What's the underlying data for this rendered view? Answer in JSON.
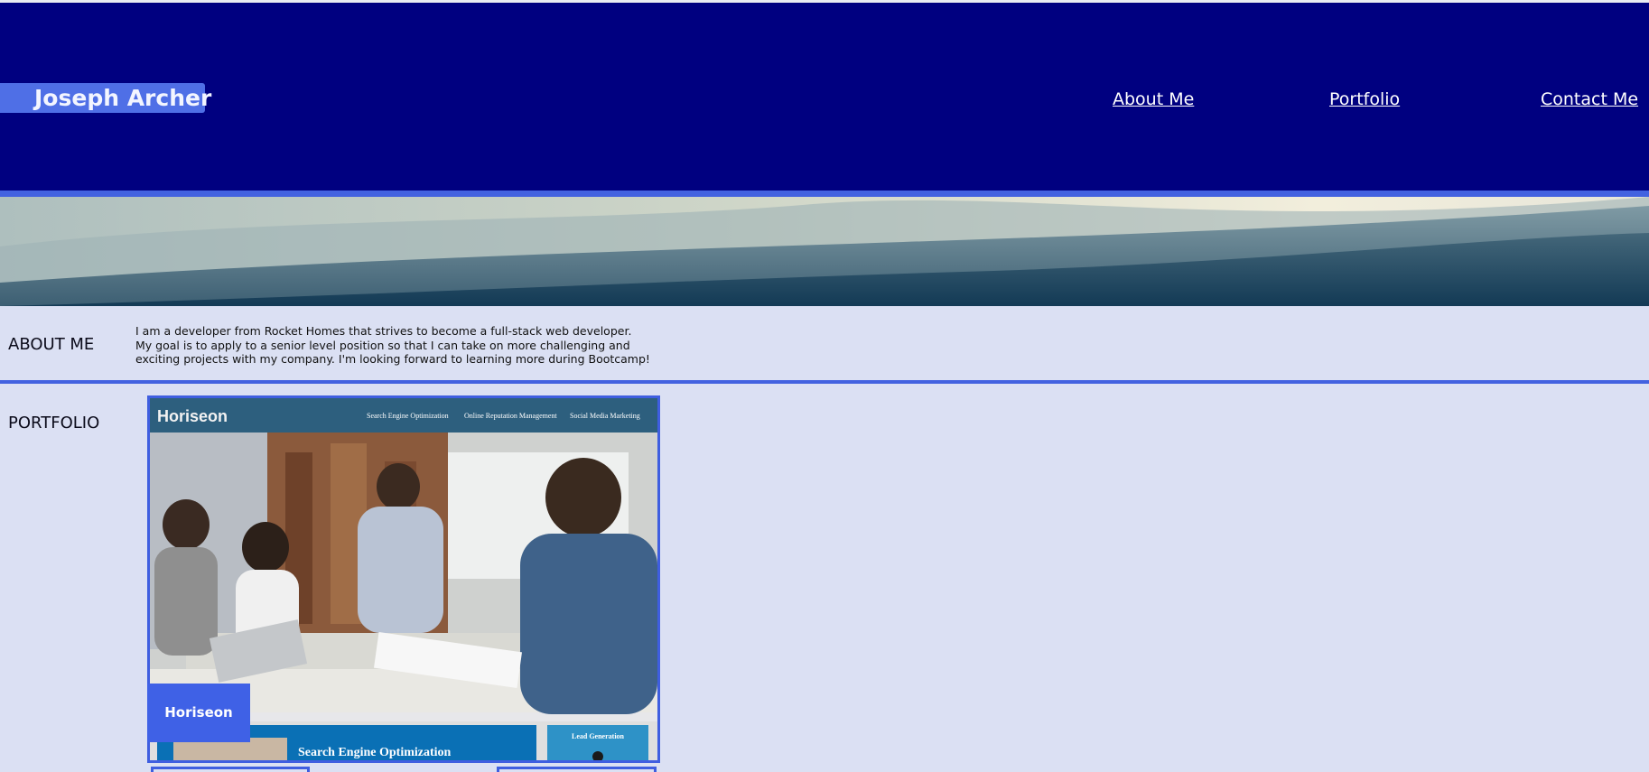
{
  "header": {
    "logo_text": "Joseph Archer",
    "nav": [
      "About Me",
      "Portfolio",
      "Contact Me"
    ]
  },
  "about": {
    "title": "ABOUT ME",
    "lines": [
      "I am a developer from Rocket Homes that strives to become a full-stack web developer.",
      "My goal is to apply to a senior level position so that I can take on more challenging and",
      "exciting projects with my company. I'm looking forward to learning more during Bootcamp!"
    ]
  },
  "portfolio": {
    "title": "PORTFOLIO",
    "items": [
      {
        "label": "Horiseon",
        "screenshot": {
          "brand": "Horiseon",
          "nav": [
            "Search Engine Optimization",
            "Online Reputation Management",
            "Social Media Marketing"
          ],
          "section": "Search Engine Optimization",
          "side": "Lead Generation"
        }
      }
    ]
  },
  "colors": {
    "header_bg": "#000080",
    "accent": "#4362e0",
    "page_bg": "#dbe0f3",
    "logo_bg": "#4f6fe6"
  }
}
